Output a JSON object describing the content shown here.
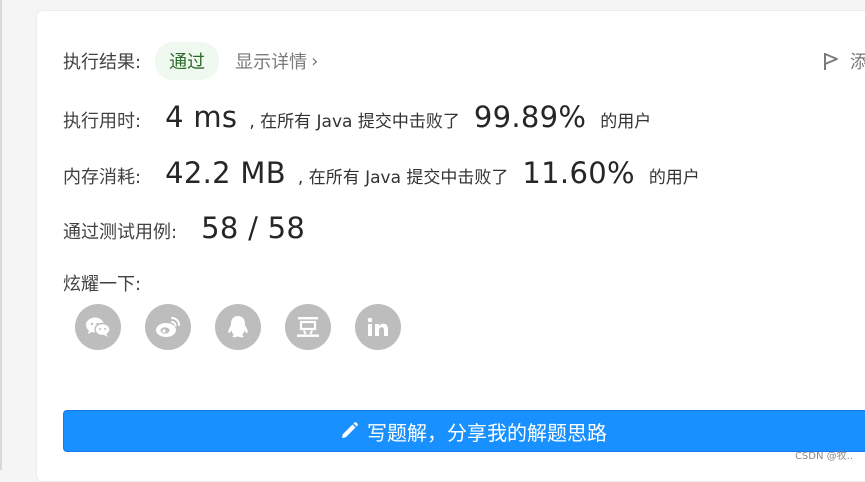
{
  "result": {
    "label": "执行结果:",
    "status": "通过",
    "details_link": "显示详情",
    "details_chevron": "›",
    "right_action_label": "添"
  },
  "runtime": {
    "label": "执行用时:",
    "value": "4 ms",
    "prefix": ", 在所有 Java 提交中击败了",
    "percent": "99.89%",
    "suffix": "的用户"
  },
  "memory": {
    "label": "内存消耗:",
    "value": "42.2 MB",
    "prefix": ", 在所有 Java 提交中击败了",
    "percent": "11.60%",
    "suffix": "的用户"
  },
  "tests": {
    "label": "通过测试用例:",
    "value": "58 / 58"
  },
  "share": {
    "label": "炫耀一下:",
    "icons": [
      "wechat-icon",
      "weibo-icon",
      "qq-icon",
      "douban-icon",
      "linkedin-icon"
    ]
  },
  "solution_button": {
    "label": "写题解，分享我的解题思路"
  },
  "watermark": "CSDN @牧..",
  "colors": {
    "primary": "#1890ff",
    "pass_bg": "#f0f9ef",
    "pass_text": "#2d6b2b",
    "icon_bg": "#bdbdbd"
  }
}
